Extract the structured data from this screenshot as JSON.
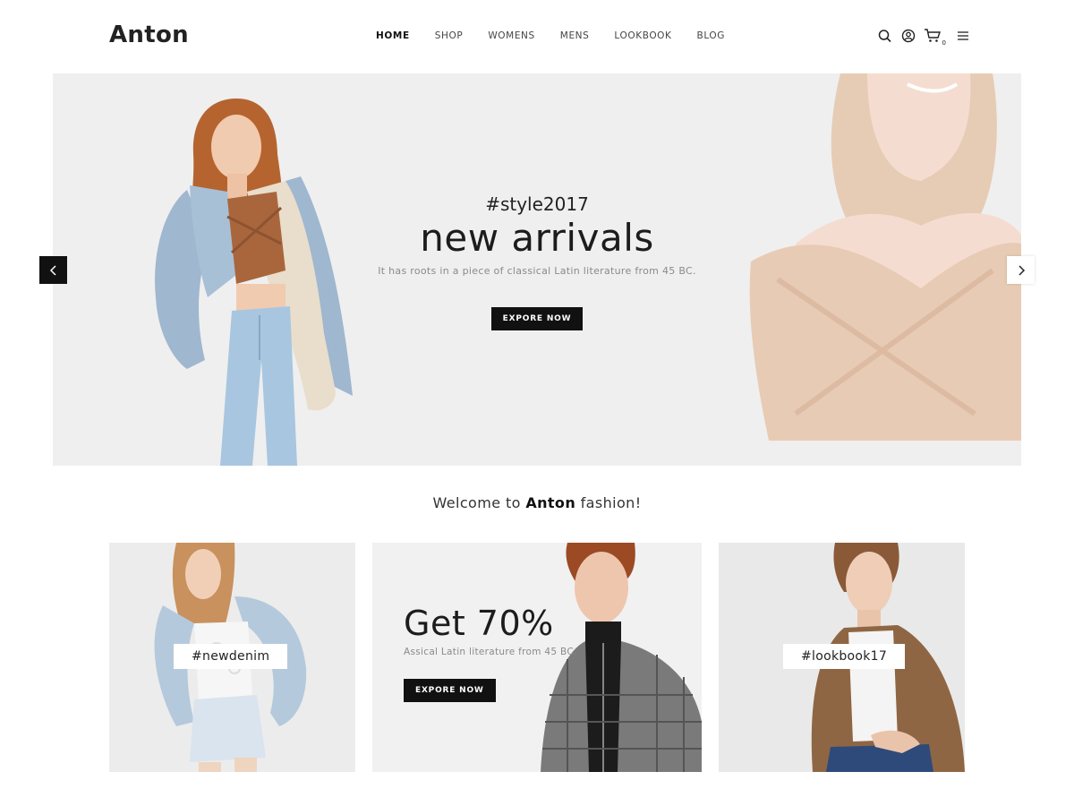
{
  "brand": {
    "logo": "Anton"
  },
  "nav": {
    "items": [
      {
        "label": "HOME",
        "active": true
      },
      {
        "label": "SHOP",
        "active": false
      },
      {
        "label": "WOMENS",
        "active": false
      },
      {
        "label": "MENS",
        "active": false
      },
      {
        "label": "LOOKBOOK",
        "active": false
      },
      {
        "label": "BLOG",
        "active": false
      }
    ]
  },
  "header_icons": {
    "search": "search-icon",
    "account": "user-icon",
    "cart": "cart-icon",
    "cart_count": "0",
    "menu": "hamburger-icon"
  },
  "hero": {
    "tag": "#style2017",
    "title": "new arrivals",
    "subtitle": "It has roots in a piece of classical Latin literature from 45 BC.",
    "button": "EXPORE NOW",
    "prev_icon": "chevron-left-icon",
    "next_icon": "chevron-right-icon"
  },
  "welcome": {
    "prefix": "Welcome to",
    "brand": "Anton",
    "suffix": "fashion!"
  },
  "promos": {
    "denim_label": "#newdenim",
    "sale_title": "Get 70%",
    "sale_subtitle": "Assical Latin literature from 45 BC.",
    "sale_button": "EXPORE NOW",
    "lookbook_label": "#lookbook17"
  },
  "colors": {
    "accent_dark": "#111111",
    "hero_bg": "#efefef",
    "muted_text": "#8a8a8a"
  }
}
